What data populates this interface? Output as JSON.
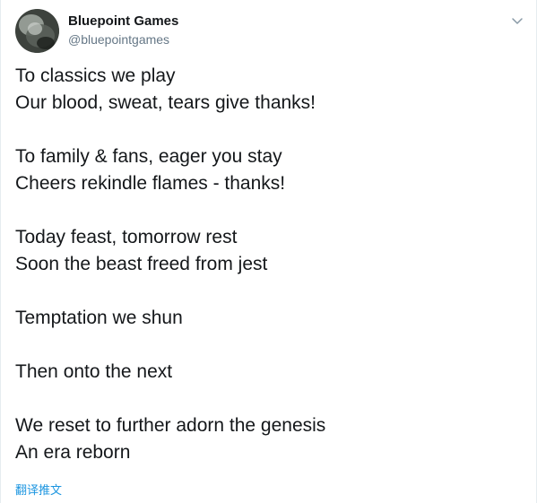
{
  "user": {
    "display_name": "Bluepoint Games",
    "handle": "@bluepointgames"
  },
  "tweet": {
    "lines": [
      "To classics we play",
      "Our blood, sweat, tears give thanks!",
      "",
      "To family & fans, eager you stay",
      "Cheers rekindle flames - thanks!",
      "",
      "Today feast, tomorrow rest",
      "Soon the beast freed from jest",
      "",
      "Temptation we shun",
      "",
      "Then onto the next",
      "",
      "We reset to further adorn the genesis",
      "An era reborn"
    ]
  },
  "translate_label": "翻译推文",
  "icons": {
    "menu": "chevron-down-icon",
    "avatar": "avatar"
  },
  "colors": {
    "text": "#14171a",
    "secondary": "#657786",
    "link": "#1b95e0",
    "border": "#e6ecf0"
  }
}
